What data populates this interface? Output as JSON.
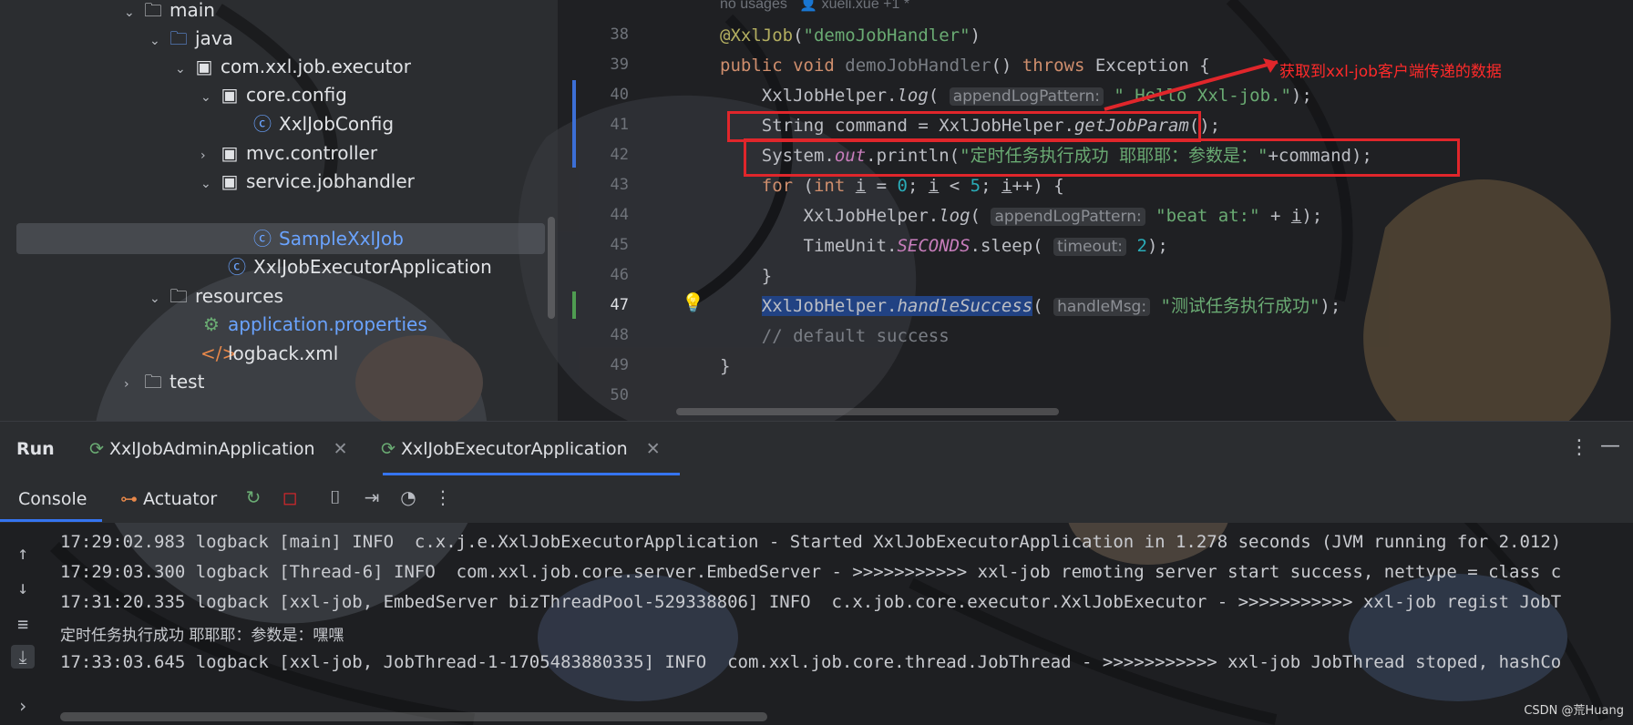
{
  "project_tree": [
    {
      "label": "main",
      "type": "folder",
      "expanded": true
    },
    {
      "label": "java",
      "type": "source-folder",
      "expanded": true
    },
    {
      "label": "com.xxl.job.executor",
      "type": "package",
      "expanded": true
    },
    {
      "label": "core.config",
      "type": "package",
      "expanded": true
    },
    {
      "label": "XxlJobConfig",
      "type": "class"
    },
    {
      "label": "mvc.controller",
      "type": "package",
      "expanded": false
    },
    {
      "label": "service.jobhandler",
      "type": "package",
      "expanded": true
    },
    {
      "label": "SampleXxlJob",
      "type": "class",
      "selected": true
    },
    {
      "label": "XxlJobExecutorApplication",
      "type": "spring-class"
    },
    {
      "label": "resources",
      "type": "resources-folder",
      "expanded": true
    },
    {
      "label": "application.properties",
      "type": "properties"
    },
    {
      "label": "logback.xml",
      "type": "xml"
    },
    {
      "label": "test",
      "type": "folder",
      "expanded": false
    }
  ],
  "editor": {
    "usage_hint": "no usages",
    "author_hint": "xueli.xue +1 *",
    "line_numbers": [
      "38",
      "39",
      "40",
      "41",
      "42",
      "43",
      "44",
      "45",
      "46",
      "47",
      "48",
      "49",
      "50"
    ],
    "annotation": "获取到xxl-job客户端传递的数据"
  },
  "run_panel": {
    "title": "Run",
    "tabs": [
      "XxlJobAdminApplication",
      "XxlJobExecutorApplication"
    ],
    "console_tab": "Console",
    "actuator_tab": "Actuator"
  },
  "console_lines": [
    "17:29:02.983 logback [main] INFO  c.x.j.e.XxlJobExecutorApplication - Started XxlJobExecutorApplication in 1.278 seconds (JVM running for 2.012)",
    "17:29:03.300 logback [Thread-6] INFO  com.xxl.job.core.server.EmbedServer - >>>>>>>>>>> xxl-job remoting server start success, nettype = class c",
    "17:31:20.335 logback [xxl-job, EmbedServer bizThreadPool-529338806] INFO  c.x.job.core.executor.XxlJobExecutor - >>>>>>>>>>> xxl-job regist JobT",
    "定时任务执行成功 耶耶耶：参数是：嘿嘿",
    "17:33:03.645 logback [xxl-job, JobThread-1-1705483880335] INFO  com.xxl.job.core.thread.JobThread - >>>>>>>>>>> xxl-job JobThread stoped, hashCo"
  ],
  "watermark": "CSDN @荒Huang"
}
